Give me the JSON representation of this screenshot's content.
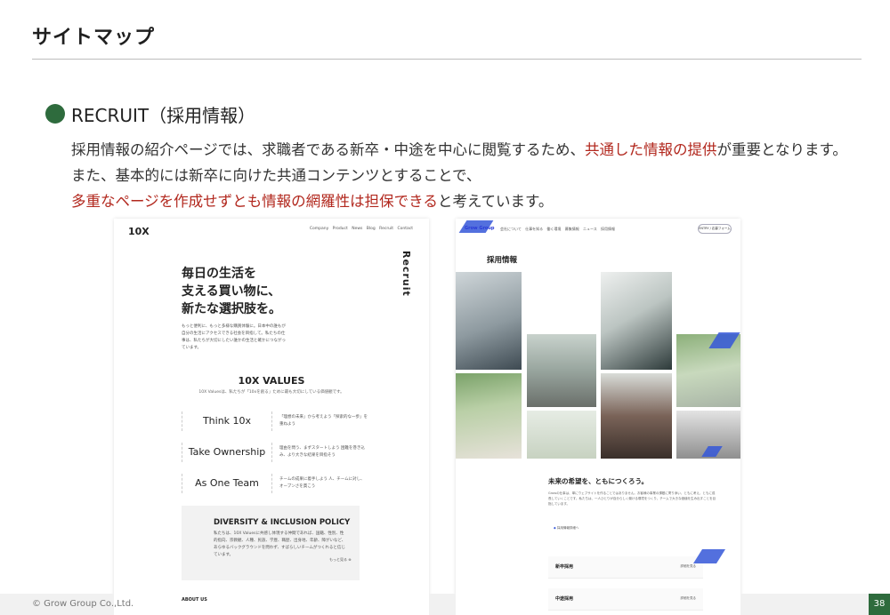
{
  "slide": {
    "title": "サイトマップ",
    "heading": "RECRUIT（採用情報）",
    "body": {
      "p1_a": "採用情報の紹介ページでは、求職者である新卒・中途を中心に閲覧するため、",
      "p1_red": "共通した情報の提供",
      "p1_b": "が重要となります。また、基本的には新卒に向けた共通コンテンツとすることで、",
      "p2_red": "多重なページを作成せずとも情報の網羅性は担保できる",
      "p2_b": "と考えています。"
    },
    "footer": {
      "copyright": "© Grow Group Co.,Ltd.",
      "page_number": "38"
    },
    "accent_color": "#2e6b3d",
    "highlight_color": "#b2281e"
  },
  "left_screenshot": {
    "logo": "10X",
    "nav": "Company Product News Blog Recruit Contact",
    "vertical_title": "Recruit",
    "main_copy": [
      "毎日の生活を",
      "支える買い物に、",
      "新たな選択肢を。"
    ],
    "sub_copy": "もっと便利に、もっと多様な購買体験に。日本中の誰もが自分の生活にアクセスできる社会を目指して。私たちの仕事は、私たちが大切にしたい誰かの生活と確かにつながっています。",
    "values_title": "10X VALUES",
    "values_sub": "10X Valuesは、私たちが「10xを創る」ために最も大切にしている価値観です。",
    "values": [
      {
        "name": "Think 10x",
        "desc": "「理想の未来」から考えよう「探索的な一歩」を重ねよう"
      },
      {
        "name": "Take Ownership",
        "desc": "理由を問う、まずスタートしよう 困難を巻き込み、より大きな結果を目指そう"
      },
      {
        "name": "As One Team",
        "desc": "チームの成果に着手しよう 人、チームに対し、オープンさを貫こう"
      }
    ],
    "policy_title": "DIVERSITY & INCLUSION POLICY",
    "policy_text": "私たちは、10X Valuesに共感し体現する仲間であれば、国籍、性別、性的指向、宗教観、人種、民族、学歴、職歴、出身地、年齢、障がいなど、あらゆるバックグラウンドを問わず、すばらしいチームがつくれると信じています。",
    "policy_more": "もっと見る",
    "about": "ABOUT US"
  },
  "right_screenshot": {
    "logo": "Grow Group",
    "nav": "会社について 仕事を知る 働く環境 募集情報 ニュース 採用情報",
    "entry_button": "ENTRY / 応募フォーム",
    "title": "採用情報",
    "future_title": "未来の希望を、ともにつくろう。",
    "future_text": "Growの仕事は、単にウェブサイトを作ることではありません。お客様の事業の課題に寄り添い、ともに考え、ともに成長していくことです。私たちは、一人ひとりが自分らしく働ける環境をつくり、チームで大きな価値を生み出すことを目指しています。",
    "link": "採用情報詳細へ",
    "rows": [
      {
        "label": "新卒採用",
        "more": "詳細を見る"
      },
      {
        "label": "中途採用",
        "more": "詳細を見る"
      }
    ]
  }
}
